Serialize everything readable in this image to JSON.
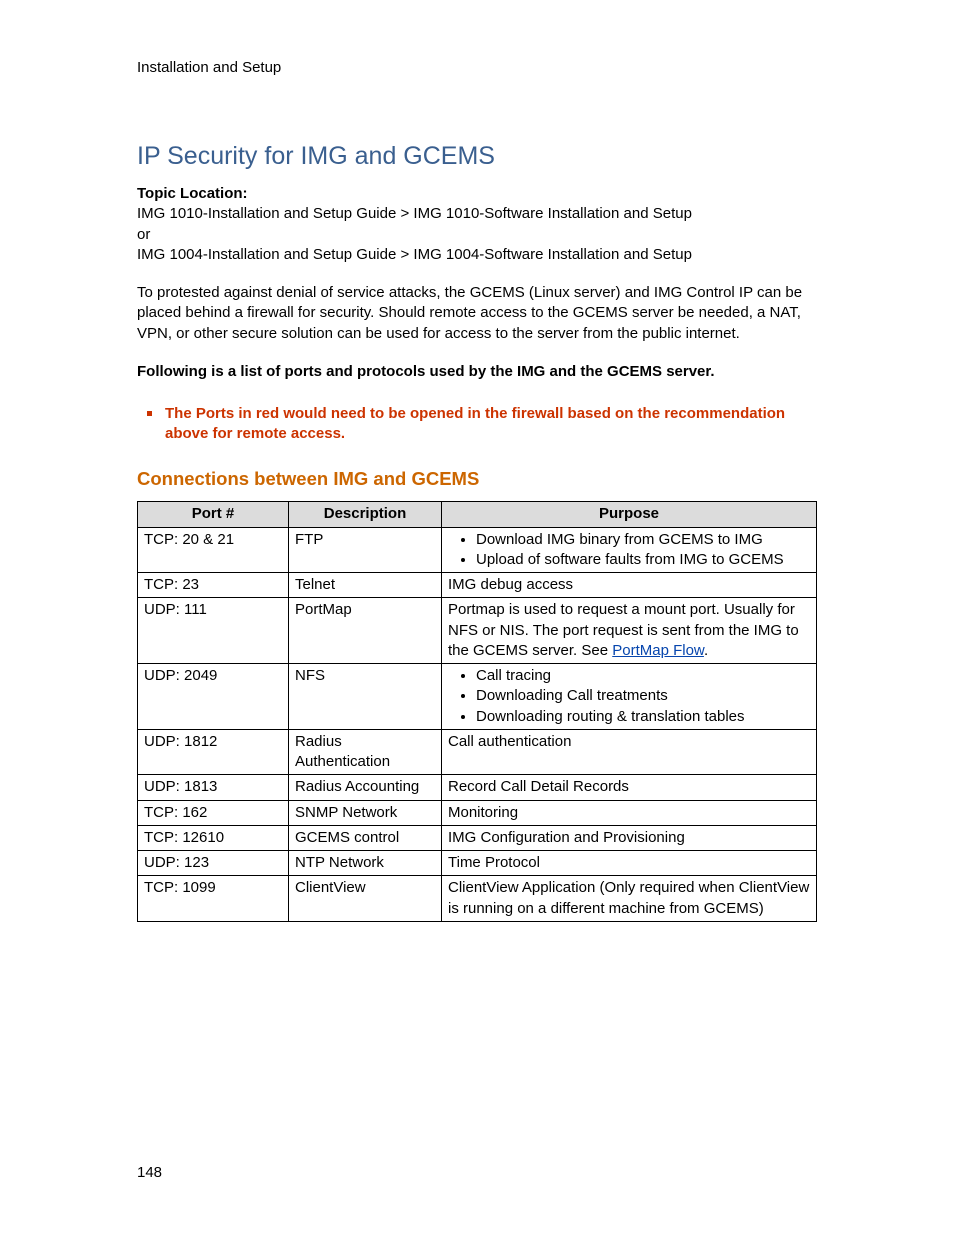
{
  "header": {
    "section": "Installation and Setup"
  },
  "title": "IP Security for IMG and GCEMS",
  "topic": {
    "label": "Topic Location:",
    "line1": "IMG 1010-Installation and Setup Guide  >  IMG 1010-Software Installation and Setup",
    "or": "or",
    "line2": "IMG 1004-Installation and Setup Guide  >  IMG 1004-Software Installation and Setup"
  },
  "intro": "To protested against denial of service attacks, the GCEMS (Linux server) and IMG Control IP can be placed behind a firewall for security.  Should remote access to the GCEMS server be needed, a NAT, VPN, or other secure solution can be used for access to the server from the public internet.",
  "following": "Following is a list of ports and protocols used by the IMG and the GCEMS server.",
  "red_bullet": "The Ports in red would need to be opened in the firewall based on the recommendation above for remote access.",
  "section_heading": "Connections between IMG and GCEMS",
  "table": {
    "headers": {
      "port": "Port #",
      "desc": "Description",
      "purpose": "Purpose"
    },
    "rows": [
      {
        "port": "TCP: 20 & 21",
        "desc": "FTP",
        "purpose_list": [
          "Download IMG binary from GCEMS to IMG",
          "Upload of software faults from IMG to GCEMS"
        ]
      },
      {
        "port": "TCP: 23",
        "desc": "Telnet",
        "purpose_text": "IMG debug access"
      },
      {
        "port": "UDP: 111",
        "desc": "PortMap",
        "purpose_pre": "Portmap is used to request a mount port. Usually for NFS or NIS. The port request is sent from the IMG to the GCEMS server. See ",
        "purpose_link": "PortMap Flow",
        "purpose_post": "."
      },
      {
        "port": "UDP: 2049",
        "desc": "NFS",
        "purpose_list": [
          "Call tracing",
          "Downloading Call treatments",
          "Downloading routing & translation tables"
        ]
      },
      {
        "port": "UDP: 1812",
        "desc": "Radius Authentication",
        "purpose_text": "Call authentication"
      },
      {
        "port": "UDP: 1813",
        "desc": "Radius Accounting",
        "purpose_text": "Record Call Detail Records"
      },
      {
        "port": "TCP: 162",
        "desc": "SNMP Network",
        "purpose_text": "Monitoring"
      },
      {
        "port": "TCP: 12610",
        "desc": "GCEMS control",
        "purpose_text": "IMG Configuration and Provisioning"
      },
      {
        "port": "UDP: 123",
        "desc": "NTP Network",
        "purpose_text": "Time Protocol"
      },
      {
        "port": "TCP: 1099",
        "desc": "ClientView",
        "purpose_text": "ClientView Application (Only required when ClientView is running on a different machine from GCEMS)"
      }
    ]
  },
  "page_number": "148"
}
